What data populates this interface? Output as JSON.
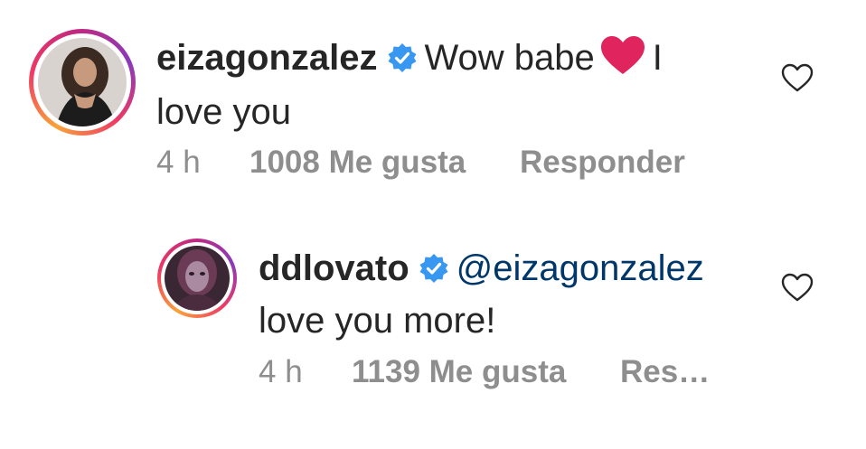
{
  "comments": [
    {
      "username": "eizagonzalez",
      "verified": true,
      "text_part1": "Wow babe",
      "emoji": "red-heart",
      "text_part2": "I",
      "text_line2": "love you",
      "time": "4 h",
      "likes": "1008 Me gusta",
      "reply_label": "Responder",
      "like_icon": "heart-outline-icon"
    },
    {
      "username": "ddlovato",
      "verified": true,
      "mention": "@eizagonzalez",
      "text_line2": "love you more!",
      "time": "4 h",
      "likes": "1139 Me gusta",
      "reply_label": "Res…",
      "like_icon": "heart-outline-icon"
    }
  ],
  "colors": {
    "text": "#262626",
    "meta": "#8e8e8e",
    "mention": "#00376b",
    "verified": "#3897f0",
    "heart": "#e0245e"
  }
}
